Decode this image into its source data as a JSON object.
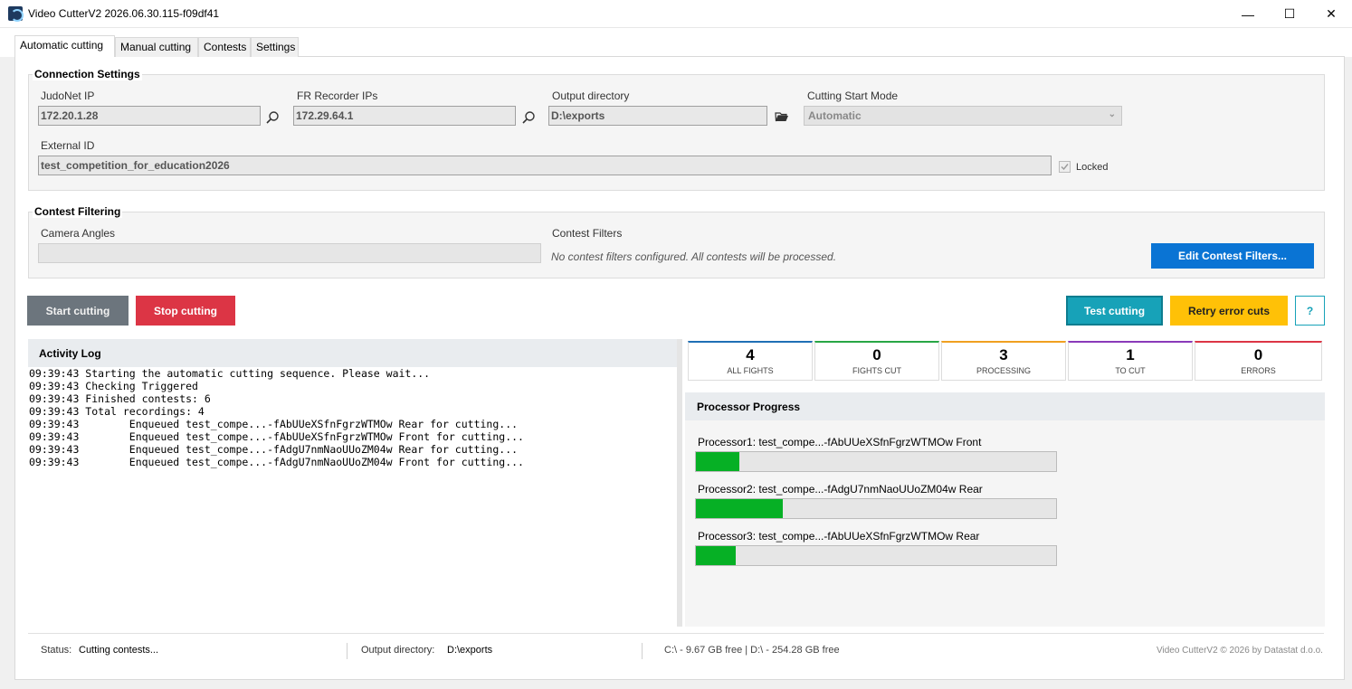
{
  "window": {
    "title": "Video CutterV2 2026.06.30.115-f09df41",
    "minimize": "—",
    "maximize": "☐",
    "close": "✕"
  },
  "tabs": [
    {
      "label": "Automatic cutting"
    },
    {
      "label": "Manual cutting"
    },
    {
      "label": "Contests"
    },
    {
      "label": "Settings"
    }
  ],
  "connection": {
    "title": "Connection Settings",
    "judonet_label": "JudoNet IP",
    "judonet_value": "172.20.1.28",
    "fr_label": "FR Recorder IPs",
    "fr_value": "172.29.64.1",
    "output_label": "Output directory",
    "output_value": "D:\\exports",
    "mode_label": "Cutting Start Mode",
    "mode_value": "Automatic",
    "external_label": "External ID",
    "external_value": "test_competition_for_education2026",
    "locked_label": "Locked"
  },
  "filtering": {
    "title": "Contest Filtering",
    "camera_label": "Camera Angles",
    "camera_value": "",
    "filters_label": "Contest Filters",
    "filters_text": "No contest filters configured. All contests will be processed.",
    "edit_button": "Edit Contest Filters..."
  },
  "actions": {
    "start": "Start cutting",
    "stop": "Stop cutting",
    "test": "Test cutting",
    "retry": "Retry error cuts",
    "help": "?"
  },
  "log": {
    "title": "Activity Log",
    "lines": [
      "09:39:43 Starting the automatic cutting sequence. Please wait...",
      "09:39:43 Checking Triggered",
      "09:39:43 Finished contests: 6",
      "09:39:43 Total recordings: 4",
      "09:39:43        Enqueued test_compe...-fAbUUeXSfnFgrzWTMOw Rear for cutting...",
      "09:39:43        Enqueued test_compe...-fAbUUeXSfnFgrzWTMOw Front for cutting...",
      "09:39:43        Enqueued test_compe...-fAdgU7nmNaoUUoZM04w Rear for cutting...",
      "09:39:43        Enqueued test_compe...-fAdgU7nmNaoUUoZM04w Front for cutting..."
    ]
  },
  "stats": [
    {
      "value": "4",
      "label": "ALL FIGHTS",
      "color": "#1f6fb5"
    },
    {
      "value": "0",
      "label": "FIGHTS CUT",
      "color": "#28a745"
    },
    {
      "value": "3",
      "label": "PROCESSING",
      "color": "#f0a020"
    },
    {
      "value": "1",
      "label": "TO CUT",
      "color": "#8a3ab9"
    },
    {
      "value": "0",
      "label": "ERRORS",
      "color": "#dc3545"
    }
  ],
  "processors": {
    "title": "Processor Progress",
    "items": [
      {
        "label": "Processor1: test_compe...-fAbUUeXSfnFgrzWTMOw Front",
        "progress": 0.12
      },
      {
        "label": "Processor2: test_compe...-fAdgU7nmNaoUUoZM04w Rear",
        "progress": 0.24
      },
      {
        "label": "Processor3: test_compe...-fAbUUeXSfnFgrzWTMOw Rear",
        "progress": 0.11
      }
    ]
  },
  "status": {
    "status_label": "Status:",
    "status_value": "Cutting contests...",
    "output_label": "Output directory:",
    "output_value": "D:\\exports",
    "disk": "C:\\ - 9.67 GB free | D:\\ - 254.28 GB free",
    "copyright": "Video CutterV2 © 2026 by Datastat d.o.o."
  },
  "colors": {
    "start": "#6c757d",
    "stop": "#dc3545",
    "test": "#17a2b8",
    "retry": "#ffc107",
    "edit": "#0a74d4",
    "progress_fill": "#06b025"
  }
}
